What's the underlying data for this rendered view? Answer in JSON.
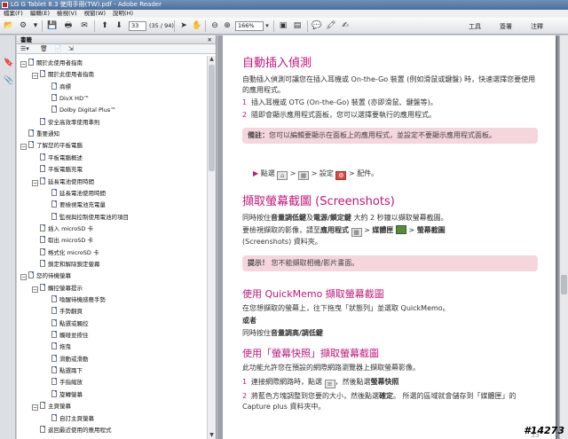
{
  "window": {
    "title": "LG G Tablet 8.3 使用手冊(TW).pdf - Adobe Reader"
  },
  "menu": [
    "檔案(F)",
    "編輯(E)",
    "檢視(V)",
    "視窗(W)",
    "說明(H)"
  ],
  "toolbar": {
    "page_current": "33",
    "page_total": "(35 / 94)",
    "zoom": "166%",
    "tools_label": "工具",
    "sign_label": "簽署",
    "comment_label": "注釋"
  },
  "bookmarks_panel": {
    "title": "書籤",
    "items": [
      {
        "label": "關於此使用者指南",
        "level": 0,
        "toggle": "−"
      },
      {
        "label": "關於此使用者指南",
        "level": 1,
        "toggle": "−"
      },
      {
        "label": "商標",
        "level": 2,
        "toggle": ""
      },
      {
        "label": "DivX HD™",
        "level": 2,
        "toggle": ""
      },
      {
        "label": "Dolby Digital Plus™",
        "level": 2,
        "toggle": ""
      },
      {
        "label": "安全高效率使用準則",
        "level": 1,
        "toggle": ""
      },
      {
        "label": "重要通知",
        "level": 0,
        "toggle": ""
      },
      {
        "label": "了解您的平板電腦",
        "level": 0,
        "toggle": "−"
      },
      {
        "label": "平板電腦概述",
        "level": 1,
        "toggle": ""
      },
      {
        "label": "平板電腦充電",
        "level": 1,
        "toggle": ""
      },
      {
        "label": "延長電池使用時間",
        "level": 1,
        "toggle": "−"
      },
      {
        "label": "延長電池使用時間",
        "level": 2,
        "toggle": ""
      },
      {
        "label": "要檢視電池充電量",
        "level": 2,
        "toggle": ""
      },
      {
        "label": "監視與控制使用電池的項目",
        "level": 2,
        "toggle": ""
      },
      {
        "label": "插入 microSD 卡",
        "level": 1,
        "toggle": ""
      },
      {
        "label": "取出 microSD 卡",
        "level": 1,
        "toggle": ""
      },
      {
        "label": "格式化 microSD 卡",
        "level": 1,
        "toggle": ""
      },
      {
        "label": "鎖定和解除鎖定螢幕",
        "level": 1,
        "toggle": ""
      },
      {
        "label": "您的待機螢幕",
        "level": 0,
        "toggle": "−"
      },
      {
        "label": "觸控螢幕提示",
        "level": 1,
        "toggle": "−"
      },
      {
        "label": "喚醒待機感應手勢",
        "level": 2,
        "toggle": ""
      },
      {
        "label": "手勢翻頁",
        "level": 2,
        "toggle": ""
      },
      {
        "label": "點選或觸控",
        "level": 2,
        "toggle": ""
      },
      {
        "label": "觸碰並按住",
        "level": 2,
        "toggle": ""
      },
      {
        "label": "拖曳",
        "level": 2,
        "toggle": ""
      },
      {
        "label": "滑動或滑動",
        "level": 2,
        "toggle": ""
      },
      {
        "label": "點選兩下",
        "level": 2,
        "toggle": ""
      },
      {
        "label": "手指縮放",
        "level": 2,
        "toggle": ""
      },
      {
        "label": "旋轉螢幕",
        "level": 2,
        "toggle": ""
      },
      {
        "label": "主頁螢幕",
        "level": 1,
        "toggle": "−"
      },
      {
        "label": "自訂主頁螢幕",
        "level": 2,
        "toggle": ""
      },
      {
        "label": "返回最近使用的應用程式",
        "level": 1,
        "toggle": ""
      }
    ]
  },
  "page": {
    "s1_title": "自動插入偵測",
    "s1_p": "自動插入偵測可讓您在插入耳機或 On-the-Go 裝置 (例如滑鼠或鍵盤) 時，快速選擇您要使用的應用程式。",
    "s1_step1": "插入耳機或 OTG (On-the-Go) 裝置 (亦即滑鼠、鍵盤等)。",
    "s1_step2": "隨即會顯示應用程式面板，您可以選擇要執行的應用程式。",
    "note1_label": "備註：",
    "note1_text": "您可以編輯要顯示在面板上的應用程式，並設定不要顯示應用程式面板。",
    "path_prefix": "點選",
    "path_settings": "設定",
    "path_accessory": "配件。",
    "s2_title": "擷取螢幕截圖 (Screenshots)",
    "s2_p1a": "同時按住",
    "s2_p1b": "音量調低鍵",
    "s2_p1c": "及",
    "s2_p1d": "電源/鎖定鍵",
    "s2_p1e": " 大約 2 秒鐘以擷取螢幕截圖。",
    "s2_p2a": "要檢視擷取的影像，請至",
    "s2_p2b": "應用程式",
    "s2_p2c": "媒體匣",
    "s2_p2d": "螢幕截圖",
    "s2_p2e": "(Screenshots) 資料夾。",
    "note2_label": "提示！",
    "note2_text": "您不能擷取相機/影片畫面。",
    "s3_title": "使用 QuickMemo 擷取螢幕截圖",
    "s3_p1": "在您想擷取的螢幕上，往下拖曳「狀態列」並選取 QuickMemo。",
    "s3_or": "或者",
    "s3_p2a": "同時按住",
    "s3_p2b": "音量調高/調低鍵",
    "s4_title": "使用「螢幕快照」擷取螢幕截圖",
    "s4_p": "此功能允許您在預設的網際網路瀏覽器上擷取螢幕影像。",
    "s4_step1a": "連接網際網路時，點選",
    "s4_step1b": "，然後點選",
    "s4_step1c": "螢幕快照",
    "s4_step2a": "將藍色方塊調整到您要的大小，然後點選",
    "s4_step2b": "確定",
    "s4_step2c": "所選的區域就會儲存到「媒體匣」的 Capture plus 資料夾中。",
    "page_number": "33"
  },
  "watermark": "#14273"
}
